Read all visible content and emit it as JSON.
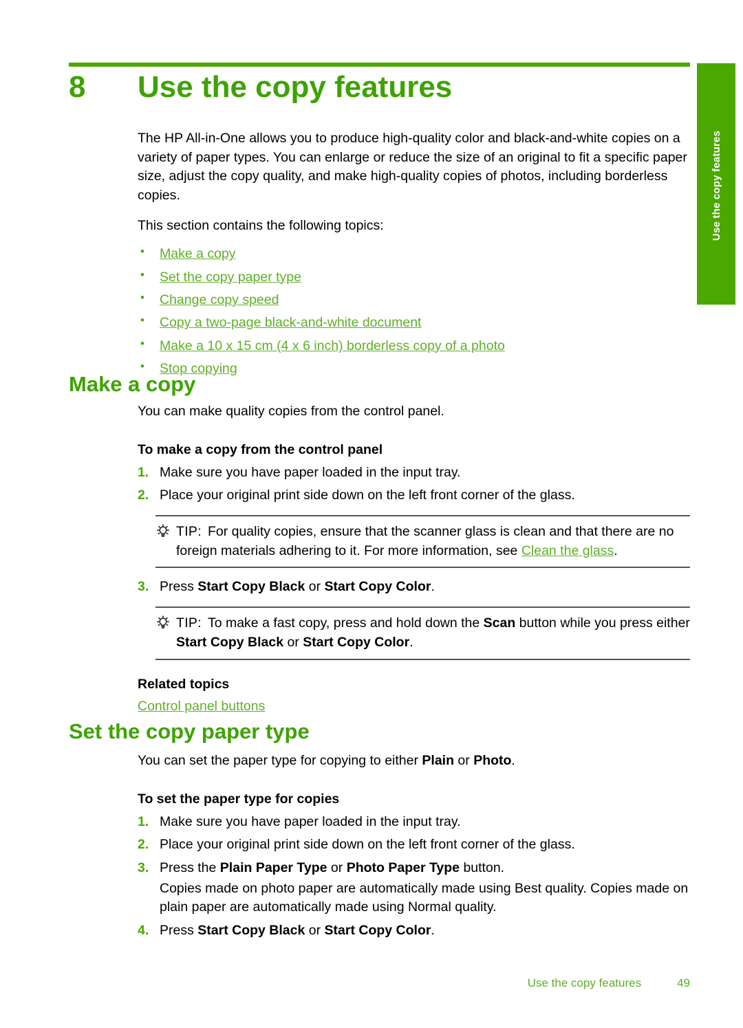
{
  "document": {
    "chapter_number": "8",
    "chapter_title": "Use the copy features",
    "side_tab_label": "Use the copy features"
  },
  "colors": {
    "heading_green": "#3da300",
    "tab_green": "#4aa800",
    "link_green": "#5faf28",
    "rule_gray": "#555555"
  },
  "intro": {
    "paragraph": "The HP All-in-One allows you to produce high-quality color and black-and-white copies on a variety of paper types. You can enlarge or reduce the size of an original to fit a specific paper size, adjust the copy quality, and make high-quality copies of photos, including borderless copies.",
    "topics_lead": "This section contains the following topics:",
    "topics": [
      "Make a copy",
      "Set the copy paper type",
      "Change copy speed",
      "Copy a two-page black-and-white document",
      "Make a 10 x 15 cm (4 x 6 inch) borderless copy of a photo",
      "Stop copying"
    ]
  },
  "make_a_copy": {
    "heading": "Make a copy",
    "intro": "You can make quality copies from the control panel.",
    "procedure_heading": "To make a copy from the control panel",
    "steps": [
      "Make sure you have paper loaded in the input tray.",
      "Place your original print side down on the left front corner of the glass."
    ],
    "tip1": {
      "icon": "lightbulb-icon",
      "label": "TIP:",
      "text_before_link": "For quality copies, ensure that the scanner glass is clean and that there are no foreign materials adhering to it. For more information, see ",
      "link": "Clean the glass",
      "text_after_link": "."
    },
    "step3": {
      "prefix": "Press ",
      "bold1": "Start Copy Black",
      "middle": " or ",
      "bold2": "Start Copy Color",
      "suffix": "."
    },
    "tip2": {
      "icon": "lightbulb-icon",
      "label": "TIP:",
      "part1": "To make a fast copy, press and hold down the ",
      "bold1": "Scan",
      "part2": " button while you press either ",
      "bold2": "Start Copy Black",
      "part3": " or ",
      "bold3": "Start Copy Color",
      "part4": "."
    },
    "related_topics_heading": "Related topics",
    "related_topics_link": "Control panel buttons"
  },
  "set_paper_type": {
    "heading": "Set the copy paper type",
    "intro_prefix": "You can set the paper type for copying to either ",
    "intro_bold1": "Plain",
    "intro_middle": " or ",
    "intro_bold2": "Photo",
    "intro_suffix": ".",
    "procedure_heading": "To set the paper type for copies",
    "step1": "Make sure you have paper loaded in the input tray.",
    "step2": "Place your original print side down on the left front corner of the glass.",
    "step3": {
      "prefix": "Press the ",
      "bold1": "Plain Paper Type",
      "middle": " or ",
      "bold2": "Photo Paper Type",
      "suffix": " button.",
      "note": "Copies made on photo paper are automatically made using Best quality. Copies made on plain paper are automatically made using Normal quality."
    },
    "step4": {
      "prefix": "Press ",
      "bold1": "Start Copy Black",
      "middle": " or ",
      "bold2": "Start Copy Color",
      "suffix": "."
    }
  },
  "footer": {
    "title": "Use the copy features",
    "page_number": "49"
  }
}
